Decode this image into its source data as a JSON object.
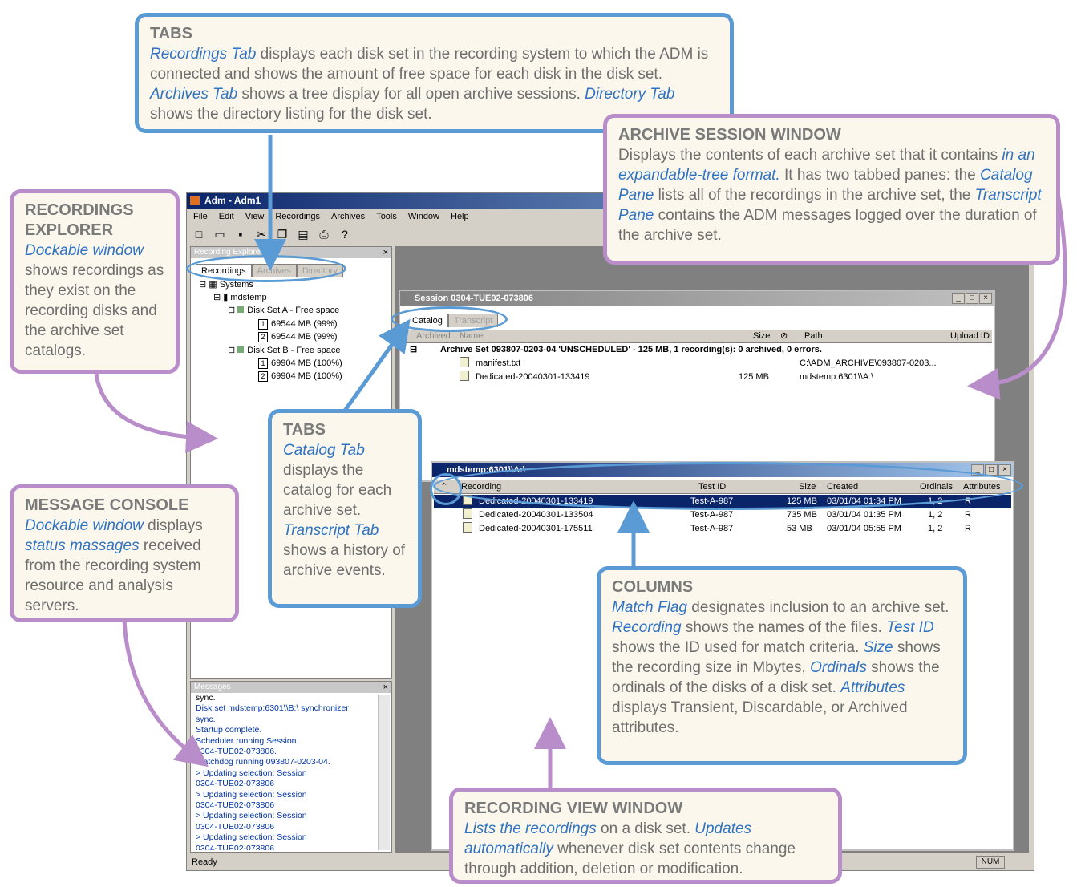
{
  "callouts": {
    "tabs_top": {
      "title": "TABS",
      "parts": [
        {
          "t": "Recordings Tab",
          "i": true
        },
        {
          "t": " displays each disk set in the recording system to which the ADM is connected and shows the amount of free space for each disk in the disk set.  ",
          "i": false
        },
        {
          "t": "Archives Tab",
          "i": true
        },
        {
          "t": " shows a tree display for all open archive sessions. ",
          "i": false
        },
        {
          "t": "Directory Tab",
          "i": true
        },
        {
          "t": " shows the directory listing for the disk set.",
          "i": false
        }
      ]
    },
    "archive_session": {
      "title": "ARCHIVE SESSION WINDOW",
      "parts": [
        {
          "t": "Displays the contents of each archive set that it contains ",
          "i": false
        },
        {
          "t": "in an expandable-tree format.",
          "i": true
        },
        {
          "t": "  It has two tabbed panes: the ",
          "i": false
        },
        {
          "t": "Catalog Pane",
          "i": true
        },
        {
          "t": " lists all of the recordings in the archive set, the ",
          "i": false
        },
        {
          "t": "Transcript Pane",
          "i": true
        },
        {
          "t": " contains the ADM messages logged over the duration of the archive set.",
          "i": false
        }
      ]
    },
    "recordings_explorer": {
      "title": "RECORDINGS EXPLORER",
      "parts": [
        {
          "t": "Dockable window",
          "i": true
        },
        {
          "t": " shows recordings as they exist on the recording disks and the archive set catalogs.",
          "i": false
        }
      ]
    },
    "message_console": {
      "title": "MESSAGE CONSOLE",
      "parts": [
        {
          "t": "Dockable window",
          "i": true
        },
        {
          "t": " displays ",
          "i": false
        },
        {
          "t": "status massages",
          "i": true
        },
        {
          "t": " received from the recording system resource and analysis servers.",
          "i": false
        }
      ]
    },
    "tabs_mid": {
      "title": "TABS",
      "parts": [
        {
          "t": "Catalog Tab",
          "i": true
        },
        {
          "t": " displays the catalog for each archive set. ",
          "i": false
        },
        {
          "t": "Transcript Tab",
          "i": true
        },
        {
          "t": " shows a history of archive events.",
          "i": false
        }
      ]
    },
    "columns": {
      "title": "COLUMNS",
      "parts": [
        {
          "t": "Match Flag",
          "i": true
        },
        {
          "t": " designates inclusion to an archive set. ",
          "i": false
        },
        {
          "t": "Recording",
          "i": true
        },
        {
          "t": " shows the names of the files. ",
          "i": false
        },
        {
          "t": "Test ID",
          "i": true
        },
        {
          "t": " shows the ID used for match criteria. ",
          "i": false
        },
        {
          "t": "Size",
          "i": true
        },
        {
          "t": " shows the recording size in Mbytes, ",
          "i": false
        },
        {
          "t": "Ordinals",
          "i": true
        },
        {
          "t": " shows the ordinals of the disks of a disk set.  ",
          "i": false
        },
        {
          "t": "Attributes",
          "i": true
        },
        {
          "t": " displays Transient, Discardable, or Archived attributes.",
          "i": false
        }
      ]
    },
    "recording_view": {
      "title": "RECORDING VIEW WINDOW",
      "parts": [
        {
          "t": "Lists the recordings",
          "i": true
        },
        {
          "t": " on a disk set.  ",
          "i": false
        },
        {
          "t": "Updates automatically",
          "i": true
        },
        {
          "t": " whenever disk set contents change through addition, deletion or modification.",
          "i": false
        }
      ]
    }
  },
  "app": {
    "title": "Adm - Adm1",
    "menu": [
      "File",
      "Edit",
      "View",
      "Recordings",
      "Archives",
      "Tools",
      "Window",
      "Help"
    ],
    "status": "Ready",
    "num": "NUM"
  },
  "explorer": {
    "header": "Recording Explorer",
    "tabs": [
      "Recordings",
      "Archives",
      "Directory"
    ],
    "tree": {
      "root": "Systems",
      "host": "mdstemp",
      "diskA": "Disk Set A - Free space",
      "diskA_items": [
        {
          "n": "1",
          "t": "69544 MB (99%)"
        },
        {
          "n": "2",
          "t": "69544 MB (99%)"
        }
      ],
      "diskB": "Disk Set B - Free space",
      "diskB_items": [
        {
          "n": "1",
          "t": "69904 MB (100%)"
        },
        {
          "n": "2",
          "t": "69904 MB (100%)"
        }
      ]
    }
  },
  "messages": {
    "header": "Messages",
    "lines": [
      "sync.",
      "Disk set mdstemp:6301\\\\B:\\ synchronizer",
      "sync.",
      "Startup complete.",
      "Scheduler running Session",
      "0304-TUE02-073806.",
      "Watchdog running 093807-0203-04.",
      "> Updating selection: Session",
      "0304-TUE02-073806",
      "> Updating selection: Session",
      "0304-TUE02-073806",
      "> Updating selection: Session",
      "0304-TUE02-073806",
      "> Updating selection: Session",
      "0304-TUE02-073806"
    ]
  },
  "session": {
    "title": "Session 0304-TUE02-073806",
    "tabs": [
      "Catalog",
      "Transcript"
    ],
    "headers": {
      "archived": "Archived",
      "name": "Name",
      "size": "Size",
      "path": "Path",
      "upload": "Upload ID"
    },
    "archive_set": "Archive Set 093807-0203-04 'UNSCHEDULED' - 125 MB, 1 recording(s): 0 archived, 0 errors.",
    "rows": [
      {
        "name": "manifest.txt",
        "size": "",
        "path": "C:\\ADM_ARCHIVE\\093807-0203..."
      },
      {
        "name": "Dedicated-20040301-133419",
        "size": "125 MB",
        "path": "mdstemp:6301\\\\A:\\"
      }
    ]
  },
  "recview": {
    "title": "mdstemp:6301\\\\A:\\",
    "headers": {
      "recording": "Recording",
      "testid": "Test ID",
      "size": "Size",
      "created": "Created",
      "ordinals": "Ordinals",
      "attributes": "Attributes"
    },
    "rows": [
      {
        "recording": "Dedicated-20040301-133419",
        "testid": "Test-A-987",
        "size": "125 MB",
        "created": "03/01/04 01:34 PM",
        "ordinals": "1, 2",
        "attributes": "R"
      },
      {
        "recording": "Dedicated-20040301-133504",
        "testid": "Test-A-987",
        "size": "735 MB",
        "created": "03/01/04 01:35 PM",
        "ordinals": "1, 2",
        "attributes": "R"
      },
      {
        "recording": "Dedicated-20040301-175511",
        "testid": "Test-A-987",
        "size": "53 MB",
        "created": "03/01/04 05:55 PM",
        "ordinals": "1, 2",
        "attributes": "R"
      }
    ]
  },
  "colors": {
    "blue": "#5b9bd5",
    "purple": "#b98dc9",
    "text_italic": "#2f73c2",
    "titlebar": "#0a246a"
  }
}
